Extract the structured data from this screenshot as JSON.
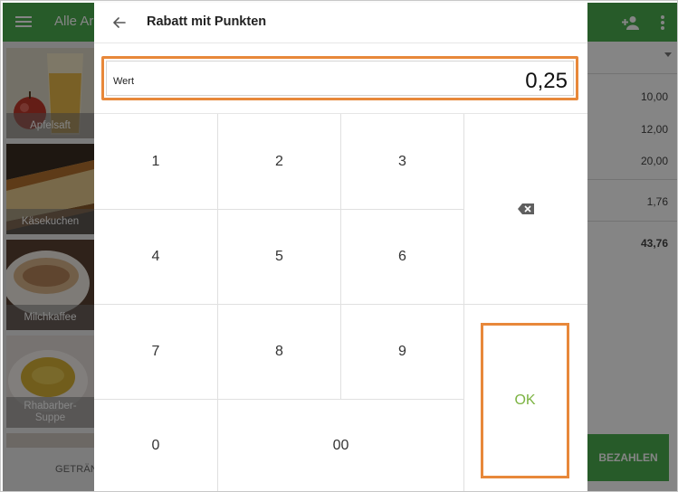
{
  "app": {
    "title_fragment": "Alle Ar",
    "tiles": [
      {
        "label": "Apfelsaft"
      },
      {
        "label": "Käsekuchen"
      },
      {
        "label": "Milchkaffee"
      },
      {
        "label": "Rhabarber-Suppe",
        "line1": "Rhabarber-",
        "line2": "Suppe"
      }
    ],
    "tab_label": "GETRÄNK",
    "amounts": [
      "10,00",
      "12,00",
      "20,00",
      "1,76"
    ],
    "total": "43,76",
    "pay_label": "BEZAHLEN",
    "colors": {
      "brand": "#4caf50",
      "highlight": "#e8883a",
      "ok_text": "#7cb342"
    }
  },
  "dialog": {
    "title": "Rabatt mit Punkten",
    "field": {
      "label": "Wert",
      "value": "0,25"
    },
    "keys": [
      "1",
      "2",
      "3",
      "4",
      "5",
      "6",
      "7",
      "8",
      "9",
      "0",
      "00"
    ],
    "ok_label": "OK",
    "icons": {
      "back": "arrow-left-icon",
      "delete": "backspace-icon"
    }
  }
}
